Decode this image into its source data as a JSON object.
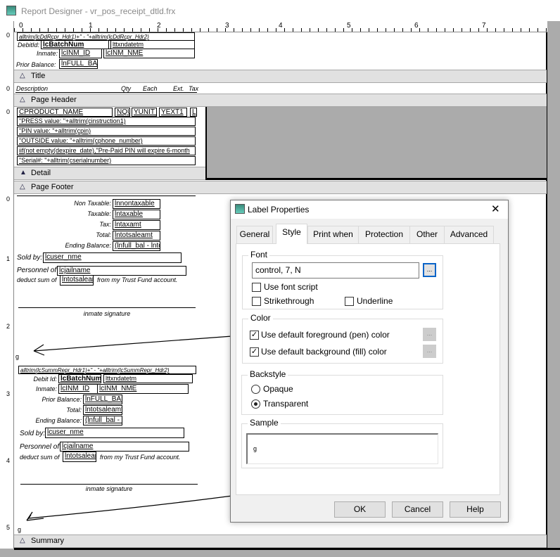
{
  "window": {
    "title": "Report Designer - vr_pos_receipt_dtld.frx",
    "icon": "report-designer-icon"
  },
  "ruler": {
    "h": [
      "0",
      "1",
      "2",
      "3",
      "4",
      "5",
      "6",
      "7"
    ],
    "v": [
      "0",
      "0",
      "0",
      "0",
      "1",
      "2",
      "3",
      "4",
      "5"
    ]
  },
  "bands": {
    "title": "Title",
    "page_header": "Page Header",
    "detail": "Detail",
    "page_footer": "Page Footer",
    "summary": "Summary"
  },
  "title_section": {
    "hdr": "alltrim(lcDdRcpr_Hdr1)+\" - \"+alltrim(lcDdRcpr_Hdr2)",
    "debit_label": "DebitId:",
    "batch": "lcBatchNum",
    "txndate": "lttxndatetm",
    "inmate_label": "Inmate:",
    "inm_id": "lcINM_ID",
    "inm_nme": "lcINM_NME",
    "prior_label": "Prior Balance:",
    "full_bal": "lnFULL_BAL"
  },
  "page_header_section": {
    "cols": [
      "Description",
      "Qty",
      "Each",
      "Ext.",
      "Tax"
    ]
  },
  "detail_section": {
    "product": "CPRODUCT_NAME",
    "nqu": "NQU",
    "yunit": "YUNIT_",
    "yext": "YEXT1",
    "l": "L",
    "lines": [
      "\"PRESS value: \"+alltrim(cinstruction1)",
      "\"PIN value: \"+alltrim(cpin)",
      "\"OUTSIDE value: \"+alltrim(cphone_number)",
      "iif(not empty(dexpire_date),\"Pre-Paid PIN will expire 6-month",
      "\"Serial#: \"+alltrim(cserialnumber)"
    ]
  },
  "footer_section": {
    "non_taxable_label": "Non Taxable:",
    "non_taxable": "lnnontaxable",
    "taxable_label": "Taxable:",
    "taxable": "lntaxable",
    "tax_label": "Tax:",
    "tax": "lntaxamt",
    "total_label": "Total:",
    "total": "lntotsaleamt",
    "ending_label": "Ending Balance:",
    "ending": "(lnfull_bal - lntot",
    "sold_label": "Sold by:",
    "sold": "lcuser_nme",
    "personnel_label": "Personnel of",
    "jail": "lcjailname",
    "deduct_label": "deduct sum of",
    "deduct_field": "lntotsaleam",
    "trust_text": "from my Trust Fund account.",
    "signature": "inmate signature",
    "g": "g"
  },
  "summary_block": {
    "hdr": "alltrim(lcSummRepr_Hdr1)+\" - \"+alltrim(lcSummRepr_Hdr2)",
    "debit_label": "Debit Id:",
    "batch": "lcBatchNum",
    "txndate": "lttxndatetm",
    "inmate_label": "Inmate:",
    "inm_id": "lcINM_ID",
    "inm_nme": "lcINM_NME",
    "prior_label": "Prior Balance:",
    "full_bal": "lnFULL_BAL",
    "total_label": "Total:",
    "total": "lntotsaleamt",
    "ending_label": "Ending Balance:",
    "ending": "(lnfull_bal - ln",
    "sold_label": "Sold by:",
    "sold": "lcuser_nme",
    "personnel_label": "Personnel of",
    "jail": "lcjailname",
    "deduct_label": "deduct sum of",
    "deduct_field": "lntotsaleam",
    "trust_text": "from my Trust Fund account.",
    "signature": "inmate signature",
    "g": "g"
  },
  "dialog": {
    "title": "Label Properties",
    "tabs": [
      "General",
      "Style",
      "Print when",
      "Protection",
      "Other",
      "Advanced"
    ],
    "active_tab": "Style",
    "font": {
      "group": "Font",
      "value": "control, 7, N",
      "button": "...",
      "use_font_script": "Use font script",
      "strikethrough": "Strikethrough",
      "underline": "Underline"
    },
    "color": {
      "group": "Color",
      "fg": "Use default foreground (pen) color",
      "bg": "Use default background (fill) color",
      "button": "...",
      "fg_checked": true,
      "bg_checked": true
    },
    "backstyle": {
      "group": "Backstyle",
      "opaque": "Opaque",
      "transparent": "Transparent",
      "selected": "Transparent"
    },
    "sample": {
      "group": "Sample",
      "text": "g"
    },
    "buttons": {
      "ok": "OK",
      "cancel": "Cancel",
      "help": "Help"
    },
    "close": "✕"
  }
}
